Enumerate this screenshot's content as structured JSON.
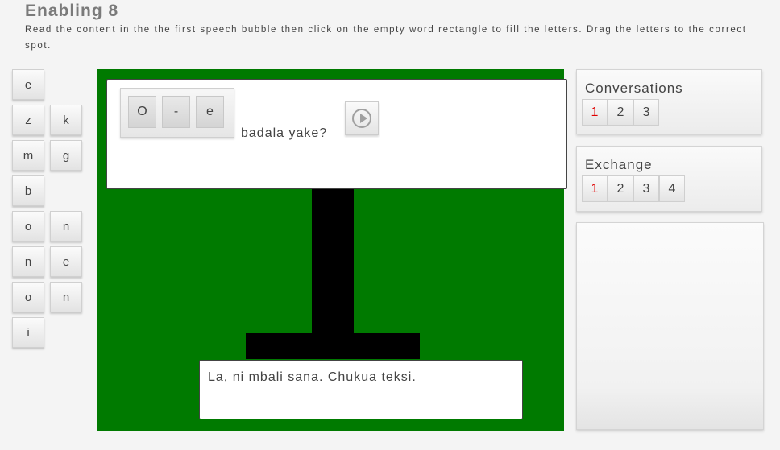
{
  "title": "Enabling 8",
  "instructions": "Read the content in the the first speech bubble then click on the empty word rectangle to fill the letters. Drag the letters to the correct spot.",
  "letter_tiles": [
    "e",
    "z",
    "k",
    "m",
    "g",
    "b",
    "o",
    "n",
    "n",
    "e",
    "o",
    "n",
    "i"
  ],
  "stage": {
    "bubble1": {
      "word_slots": [
        "O",
        "-",
        "e"
      ],
      "text": "badala yake?",
      "play_icon": "play-circle-icon"
    },
    "bubble2": {
      "text": "La, ni mbali sana. Chukua teksi."
    }
  },
  "conversations": {
    "label": "Conversations",
    "items": [
      "1",
      "2",
      "3"
    ],
    "active": "1"
  },
  "exchange": {
    "label": "Exchange",
    "items": [
      "1",
      "2",
      "3",
      "4"
    ],
    "active": "1"
  },
  "colors": {
    "stage_bg": "#007a00",
    "active_number": "#e00000"
  }
}
